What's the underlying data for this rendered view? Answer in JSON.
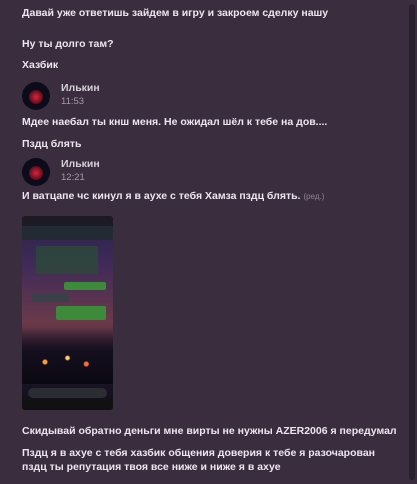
{
  "messages": {
    "m1": "Давай уже ответишь зайдем в игру и закроем сделку нашу",
    "m2": "Ну ты долго там?",
    "m3": "Хазбик",
    "m4": "Мдее наебал ты кнш меня. Не ожидал шёл к тебе на дов....",
    "m5": "Пздц блять",
    "m6": "И ватцапе чс кинул я в аухе с тебя Хамза пздц блять.",
    "m6_edited": "(ред.)",
    "m7": "Скидывай обратно деньги мне вирты не нужны AZER2006 я передумал",
    "m8": "Пздц я в ахуе с тебя хазбик общения доверия к тебе я разочарован пздц ты репутация твоя все ниже и ниже я в ахуе"
  },
  "group1": {
    "author": "Илькин",
    "time": "11:53"
  },
  "group2": {
    "author": "Илькин",
    "time": "12:21"
  },
  "icons": {
    "avatar": "user-avatar",
    "attachment": "screenshot-image"
  }
}
